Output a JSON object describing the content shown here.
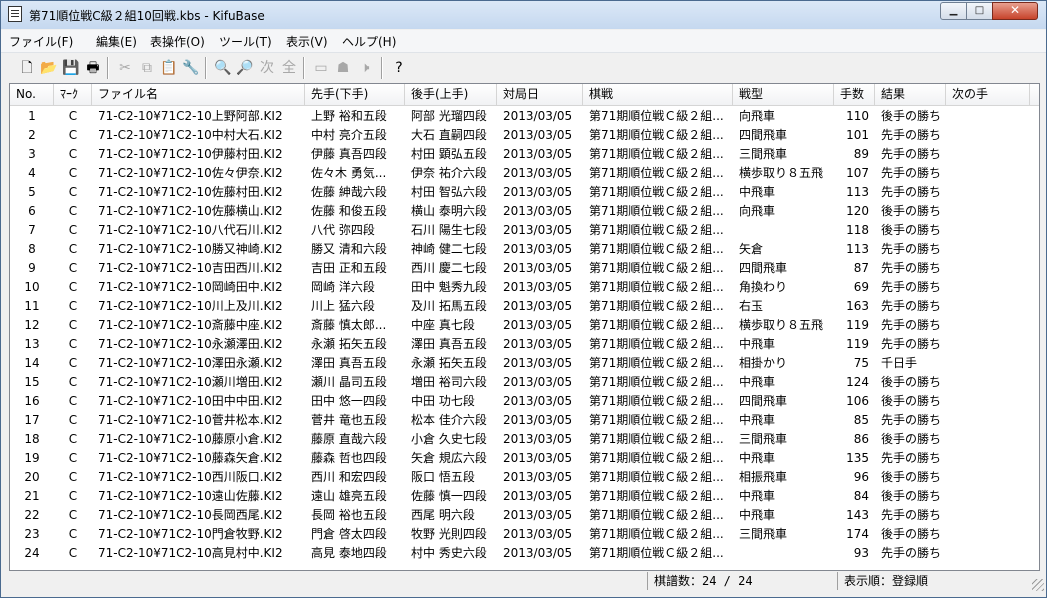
{
  "window": {
    "title": "第71順位戦C級２組10回戦.kbs - KifuBase",
    "min_label": "▁",
    "max_label": "□",
    "close_label": "✕"
  },
  "menu": [
    {
      "label": "ファイル(F)"
    },
    {
      "label": "編集(E)"
    },
    {
      "label": "表操作(O)"
    },
    {
      "label": "ツール(T)"
    },
    {
      "label": "表示(V)"
    },
    {
      "label": "ヘルプ(H)"
    }
  ],
  "toolbar": [
    {
      "icon": "new-file-icon",
      "glyph": "🗋",
      "enabled": true
    },
    {
      "icon": "open-folder-icon",
      "glyph": "📂",
      "enabled": true
    },
    {
      "icon": "save-icon",
      "glyph": "💾",
      "enabled": true
    },
    {
      "icon": "print-icon",
      "glyph": "🖶",
      "enabled": true
    },
    {
      "icon": "cut-icon",
      "glyph": "✂",
      "enabled": false
    },
    {
      "icon": "copy-icon",
      "glyph": "⧉",
      "enabled": false
    },
    {
      "icon": "paste-icon",
      "glyph": "📋",
      "enabled": false
    },
    {
      "icon": "properties-icon",
      "glyph": "🔧",
      "enabled": true
    },
    {
      "icon": "find-icon",
      "glyph": "🔍",
      "enabled": true
    },
    {
      "icon": "find-replace-icon",
      "glyph": "🔎",
      "enabled": false
    },
    {
      "icon": "find-next-icon",
      "glyph": "次",
      "enabled": false
    },
    {
      "icon": "select-all-icon",
      "glyph": "全",
      "enabled": false
    },
    {
      "icon": "board-icon",
      "glyph": "▭",
      "enabled": false
    },
    {
      "icon": "piece-icon",
      "glyph": "☗",
      "enabled": false
    },
    {
      "icon": "sound-icon",
      "glyph": "🕨",
      "enabled": false
    },
    {
      "icon": "help-icon",
      "glyph": "?",
      "enabled": true
    }
  ],
  "columns": [
    "No.",
    "ﾏｰｸ",
    "ファイル名",
    "先手(下手)",
    "後手(上手)",
    "対局日",
    "棋戦",
    "戦型",
    "手数",
    "結果",
    "次の手"
  ],
  "rows": [
    {
      "no": "1",
      "mark": "C",
      "file": "71-C2-10¥71C2-10上野阿部.KI2",
      "sente": "上野 裕和五段",
      "gote": "阿部 光瑠四段",
      "date": "2013/03/05",
      "event": "第71期順位戦Ｃ級２組...",
      "strategy": "向飛車",
      "moves": "110",
      "result": "後手の勝ち"
    },
    {
      "no": "2",
      "mark": "C",
      "file": "71-C2-10¥71C2-10中村大石.KI2",
      "sente": "中村 亮介五段",
      "gote": "大石 直嗣四段",
      "date": "2013/03/05",
      "event": "第71期順位戦Ｃ級２組...",
      "strategy": "四間飛車",
      "moves": "101",
      "result": "先手の勝ち"
    },
    {
      "no": "3",
      "mark": "C",
      "file": "71-C2-10¥71C2-10伊藤村田.KI2",
      "sente": "伊藤 真吾四段",
      "gote": "村田 顕弘五段",
      "date": "2013/03/05",
      "event": "第71期順位戦Ｃ級２組...",
      "strategy": "三間飛車",
      "moves": "89",
      "result": "先手の勝ち"
    },
    {
      "no": "4",
      "mark": "C",
      "file": "71-C2-10¥71C2-10佐々伊奈.KI2",
      "sente": "佐々木 勇気...",
      "gote": "伊奈 祐介六段",
      "date": "2013/03/05",
      "event": "第71期順位戦Ｃ級２組...",
      "strategy": "横歩取り８五飛",
      "moves": "107",
      "result": "先手の勝ち"
    },
    {
      "no": "5",
      "mark": "C",
      "file": "71-C2-10¥71C2-10佐藤村田.KI2",
      "sente": "佐藤 紳哉六段",
      "gote": "村田 智弘六段",
      "date": "2013/03/05",
      "event": "第71期順位戦Ｃ級２組...",
      "strategy": "中飛車",
      "moves": "113",
      "result": "先手の勝ち"
    },
    {
      "no": "6",
      "mark": "C",
      "file": "71-C2-10¥71C2-10佐藤横山.KI2",
      "sente": "佐藤 和俊五段",
      "gote": "横山 泰明六段",
      "date": "2013/03/05",
      "event": "第71期順位戦Ｃ級２組...",
      "strategy": "向飛車",
      "moves": "120",
      "result": "後手の勝ち"
    },
    {
      "no": "7",
      "mark": "C",
      "file": "71-C2-10¥71C2-10八代石川.KI2",
      "sente": "八代 弥四段",
      "gote": "石川 陽生七段",
      "date": "2013/03/05",
      "event": "第71期順位戦Ｃ級２組...",
      "strategy": "",
      "moves": "118",
      "result": "後手の勝ち"
    },
    {
      "no": "8",
      "mark": "C",
      "file": "71-C2-10¥71C2-10勝又神崎.KI2",
      "sente": "勝又 清和六段",
      "gote": "神崎 健二七段",
      "date": "2013/03/05",
      "event": "第71期順位戦Ｃ級２組...",
      "strategy": "矢倉",
      "moves": "113",
      "result": "先手の勝ち"
    },
    {
      "no": "9",
      "mark": "C",
      "file": "71-C2-10¥71C2-10吉田西川.KI2",
      "sente": "吉田 正和五段",
      "gote": "西川 慶二七段",
      "date": "2013/03/05",
      "event": "第71期順位戦Ｃ級２組...",
      "strategy": "四間飛車",
      "moves": "87",
      "result": "先手の勝ち"
    },
    {
      "no": "10",
      "mark": "C",
      "file": "71-C2-10¥71C2-10岡崎田中.KI2",
      "sente": "岡崎 洋六段",
      "gote": "田中 魁秀九段",
      "date": "2013/03/05",
      "event": "第71期順位戦Ｃ級２組...",
      "strategy": "角換わり",
      "moves": "69",
      "result": "先手の勝ち"
    },
    {
      "no": "11",
      "mark": "C",
      "file": "71-C2-10¥71C2-10川上及川.KI2",
      "sente": "川上 猛六段",
      "gote": "及川 拓馬五段",
      "date": "2013/03/05",
      "event": "第71期順位戦Ｃ級２組...",
      "strategy": "右玉",
      "moves": "163",
      "result": "先手の勝ち"
    },
    {
      "no": "12",
      "mark": "C",
      "file": "71-C2-10¥71C2-10斎藤中座.KI2",
      "sente": "斎藤 慎太郎...",
      "gote": "中座 真七段",
      "date": "2013/03/05",
      "event": "第71期順位戦Ｃ級２組...",
      "strategy": "横歩取り８五飛",
      "moves": "119",
      "result": "先手の勝ち"
    },
    {
      "no": "13",
      "mark": "C",
      "file": "71-C2-10¥71C2-10永瀬澤田.KI2",
      "sente": "永瀬 拓矢五段",
      "gote": "澤田 真吾五段",
      "date": "2013/03/05",
      "event": "第71期順位戦Ｃ級２組...",
      "strategy": "中飛車",
      "moves": "119",
      "result": "先手の勝ち"
    },
    {
      "no": "14",
      "mark": "C",
      "file": "71-C2-10¥71C2-10澤田永瀬.KI2",
      "sente": "澤田 真吾五段",
      "gote": "永瀬 拓矢五段",
      "date": "2013/03/05",
      "event": "第71期順位戦Ｃ級２組...",
      "strategy": "相掛かり",
      "moves": "75",
      "result": "千日手"
    },
    {
      "no": "15",
      "mark": "C",
      "file": "71-C2-10¥71C2-10瀬川増田.KI2",
      "sente": "瀬川 晶司五段",
      "gote": "増田 裕司六段",
      "date": "2013/03/05",
      "event": "第71期順位戦Ｃ級２組...",
      "strategy": "中飛車",
      "moves": "124",
      "result": "後手の勝ち"
    },
    {
      "no": "16",
      "mark": "C",
      "file": "71-C2-10¥71C2-10田中中田.KI2",
      "sente": "田中 悠一四段",
      "gote": "中田 功七段",
      "date": "2013/03/05",
      "event": "第71期順位戦Ｃ級２組...",
      "strategy": "四間飛車",
      "moves": "106",
      "result": "後手の勝ち"
    },
    {
      "no": "17",
      "mark": "C",
      "file": "71-C2-10¥71C2-10菅井松本.KI2",
      "sente": "菅井 竜也五段",
      "gote": "松本 佳介六段",
      "date": "2013/03/05",
      "event": "第71期順位戦Ｃ級２組...",
      "strategy": "中飛車",
      "moves": "85",
      "result": "先手の勝ち"
    },
    {
      "no": "18",
      "mark": "C",
      "file": "71-C2-10¥71C2-10藤原小倉.KI2",
      "sente": "藤原 直哉六段",
      "gote": "小倉 久史七段",
      "date": "2013/03/05",
      "event": "第71期順位戦Ｃ級２組...",
      "strategy": "三間飛車",
      "moves": "86",
      "result": "後手の勝ち"
    },
    {
      "no": "19",
      "mark": "C",
      "file": "71-C2-10¥71C2-10藤森矢倉.KI2",
      "sente": "藤森 哲也四段",
      "gote": "矢倉 規広六段",
      "date": "2013/03/05",
      "event": "第71期順位戦Ｃ級２組...",
      "strategy": "中飛車",
      "moves": "135",
      "result": "先手の勝ち"
    },
    {
      "no": "20",
      "mark": "C",
      "file": "71-C2-10¥71C2-10西川阪口.KI2",
      "sente": "西川 和宏四段",
      "gote": "阪口 悟五段",
      "date": "2013/03/05",
      "event": "第71期順位戦Ｃ級２組...",
      "strategy": "相振飛車",
      "moves": "96",
      "result": "後手の勝ち"
    },
    {
      "no": "21",
      "mark": "C",
      "file": "71-C2-10¥71C2-10遠山佐藤.KI2",
      "sente": "遠山 雄亮五段",
      "gote": "佐藤 慎一四段",
      "date": "2013/03/05",
      "event": "第71期順位戦Ｃ級２組...",
      "strategy": "中飛車",
      "moves": "84",
      "result": "後手の勝ち"
    },
    {
      "no": "22",
      "mark": "C",
      "file": "71-C2-10¥71C2-10長岡西尾.KI2",
      "sente": "長岡 裕也五段",
      "gote": "西尾 明六段",
      "date": "2013/03/05",
      "event": "第71期順位戦Ｃ級２組...",
      "strategy": "中飛車",
      "moves": "143",
      "result": "先手の勝ち"
    },
    {
      "no": "23",
      "mark": "C",
      "file": "71-C2-10¥71C2-10門倉牧野.KI2",
      "sente": "門倉 啓太四段",
      "gote": "牧野 光則四段",
      "date": "2013/03/05",
      "event": "第71期順位戦Ｃ級２組...",
      "strategy": "三間飛車",
      "moves": "174",
      "result": "後手の勝ち"
    },
    {
      "no": "24",
      "mark": "C",
      "file": "71-C2-10¥71C2-10高見村中.KI2",
      "sente": "高見 泰地四段",
      "gote": "村中 秀史六段",
      "date": "2013/03/05",
      "event": "第71期順位戦Ｃ級２組...",
      "strategy": "",
      "moves": "93",
      "result": "先手の勝ち"
    }
  ],
  "status": {
    "count": "棋譜数：24 / 24",
    "order": "表示順：登録順"
  }
}
